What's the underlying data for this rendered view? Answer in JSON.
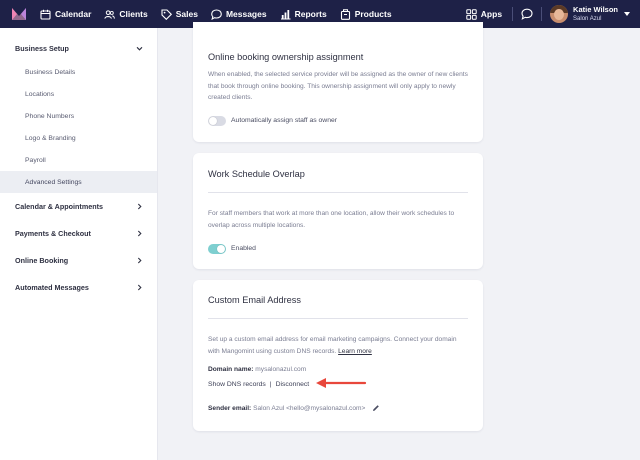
{
  "nav": {
    "items": [
      {
        "label": "Calendar",
        "icon": "calendar-icon"
      },
      {
        "label": "Clients",
        "icon": "clients-icon"
      },
      {
        "label": "Sales",
        "icon": "sales-tag-icon"
      },
      {
        "label": "Messages",
        "icon": "messages-icon"
      },
      {
        "label": "Reports",
        "icon": "reports-chart-icon"
      },
      {
        "label": "Products",
        "icon": "products-box-icon"
      }
    ],
    "apps_label": "Apps",
    "user_name": "Katie Wilson",
    "user_subtitle": "Salon Azul",
    "colors": {
      "bar": "#1e2147",
      "logo_pink": "#e85c9b",
      "logo_purple": "#7b5cf0"
    }
  },
  "sidebar": {
    "sections": [
      {
        "label": "Business Setup",
        "open": true,
        "items": [
          {
            "label": "Business Details",
            "active": false
          },
          {
            "label": "Locations",
            "active": false
          },
          {
            "label": "Phone Numbers",
            "active": false
          },
          {
            "label": "Logo & Branding",
            "active": false
          },
          {
            "label": "Payroll",
            "active": false
          },
          {
            "label": "Advanced Settings",
            "active": true
          }
        ]
      },
      {
        "label": "Calendar & Appointments",
        "open": false
      },
      {
        "label": "Payments & Checkout",
        "open": false
      },
      {
        "label": "Online Booking",
        "open": false
      },
      {
        "label": "Automated Messages",
        "open": false
      }
    ]
  },
  "cards": {
    "ownership": {
      "title": "Online booking ownership assignment",
      "description": "When enabled, the selected service provider will be assigned as the owner of new clients that book through online booking. This ownership assignment will only apply to newly created clients.",
      "toggle_label": "Automatically assign staff as owner",
      "enabled": false
    },
    "overlap": {
      "title": "Work Schedule Overlap",
      "description": "For staff members that work at more than one location, allow their work schedules to overlap across multiple locations.",
      "toggle_label": "Enabled",
      "enabled": true
    },
    "email": {
      "title": "Custom Email Address",
      "description": "Set up a custom email address for email marketing campaigns. Connect your domain with Mangomint using custom DNS records.",
      "learn_more": "Learn more",
      "domain_label": "Domain name:",
      "domain_value": "mysalonazul.com",
      "show_dns": "Show DNS records",
      "separator": "|",
      "disconnect": "Disconnect",
      "sender_label": "Sender email:",
      "sender_value": "Salon Azul <hello@mysalonazul.com>"
    }
  },
  "accent_colors": {
    "toggle_on": "#7ecfd0",
    "arrow": "#e8473b"
  }
}
